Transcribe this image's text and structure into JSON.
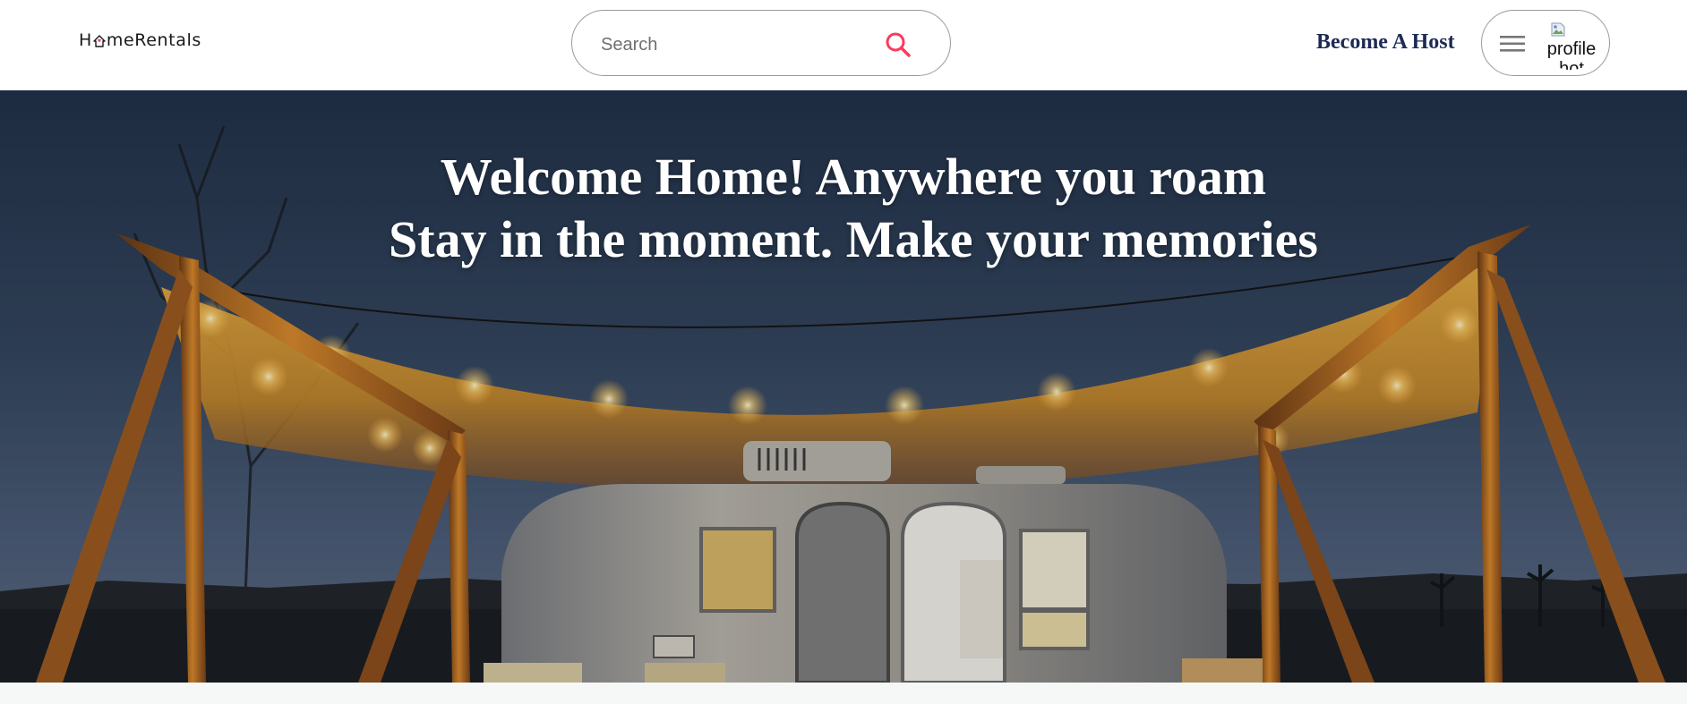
{
  "brand": {
    "logo_prefix": "H",
    "logo_suffix": "meRentals"
  },
  "search": {
    "placeholder": "Search",
    "value": ""
  },
  "header": {
    "host_label": "Become A Host",
    "profile_alt": "profile hot"
  },
  "hero": {
    "line1": "Welcome Home! Anywhere you roam",
    "line2": "Stay in the moment. Make your memories"
  },
  "colors": {
    "accent": "#ff385c",
    "host_text": "#1e2a55",
    "hero_text": "#ffffff"
  },
  "icons": [
    "house-icon",
    "search-icon",
    "menu-icon",
    "broken-image-icon"
  ]
}
